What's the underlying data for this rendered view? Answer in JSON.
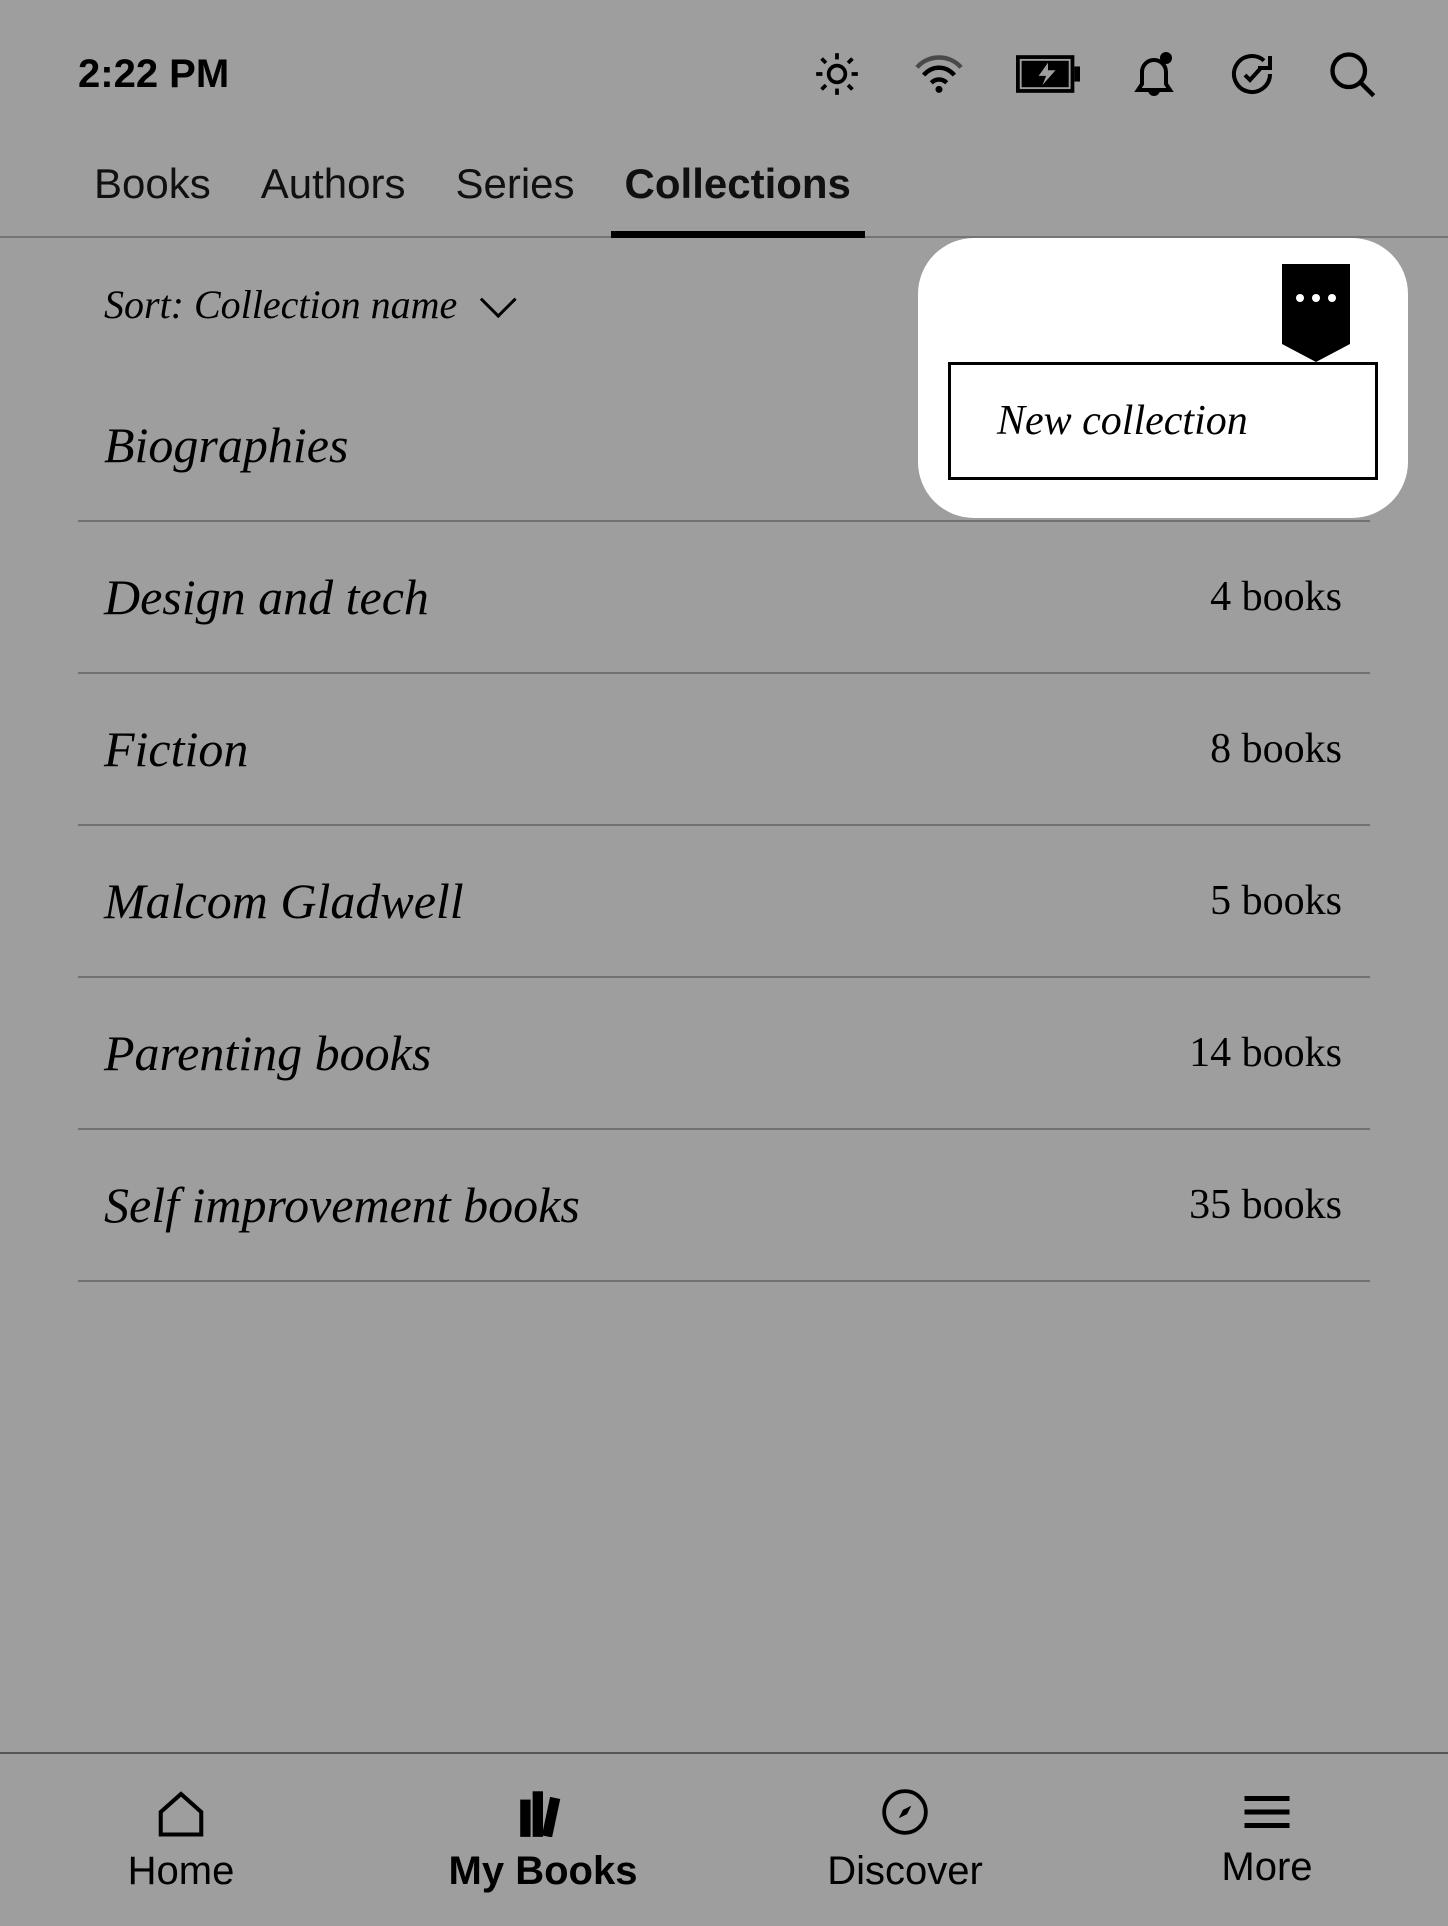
{
  "status": {
    "time": "2:22 PM"
  },
  "tabs": [
    {
      "label": "Books",
      "active": false
    },
    {
      "label": "Authors",
      "active": false
    },
    {
      "label": "Series",
      "active": false
    },
    {
      "label": "Collections",
      "active": true
    }
  ],
  "sort": {
    "label": "Sort: Collection name"
  },
  "collections": [
    {
      "name": "Biographies",
      "count": ""
    },
    {
      "name": "Design and tech",
      "count": "4 books"
    },
    {
      "name": "Fiction",
      "count": "8 books"
    },
    {
      "name": "Malcom Gladwell",
      "count": "5 books"
    },
    {
      "name": "Parenting books",
      "count": "14 books"
    },
    {
      "name": "Self improvement books",
      "count": "35 books"
    }
  ],
  "popover": {
    "new_collection": "New collection"
  },
  "nav": {
    "home": "Home",
    "mybooks": "My Books",
    "discover": "Discover",
    "more": "More"
  }
}
